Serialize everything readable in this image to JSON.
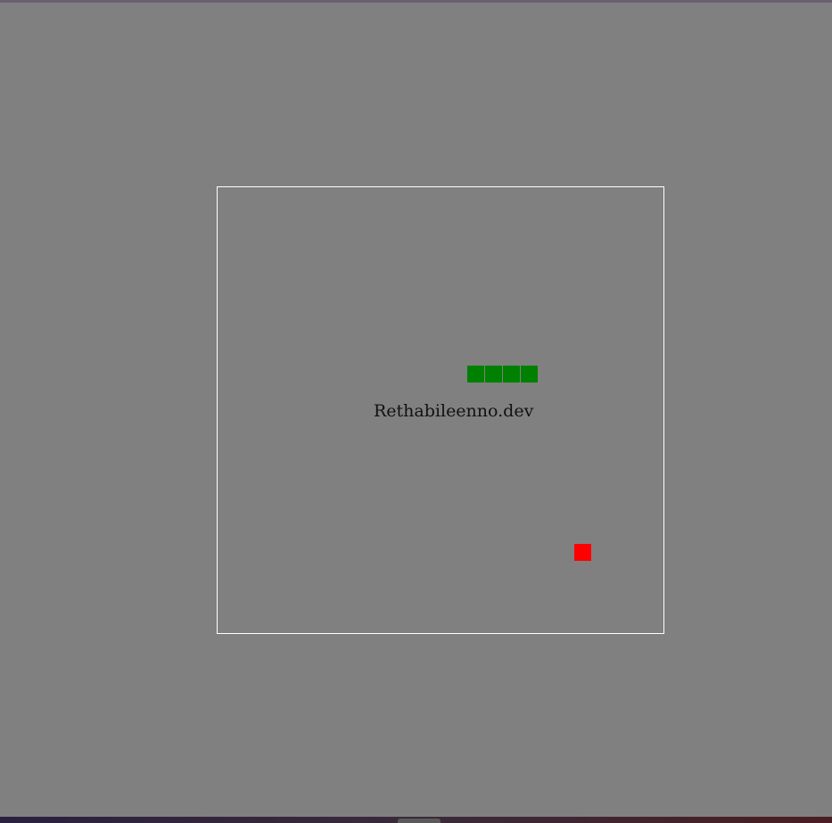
{
  "game": {
    "watermark": "Rethabileenno.dev",
    "snake_color": "#008000",
    "food_color": "#ff0000",
    "border_color": "#ffffff",
    "background_color": "#808080",
    "snake_length": 4
  }
}
